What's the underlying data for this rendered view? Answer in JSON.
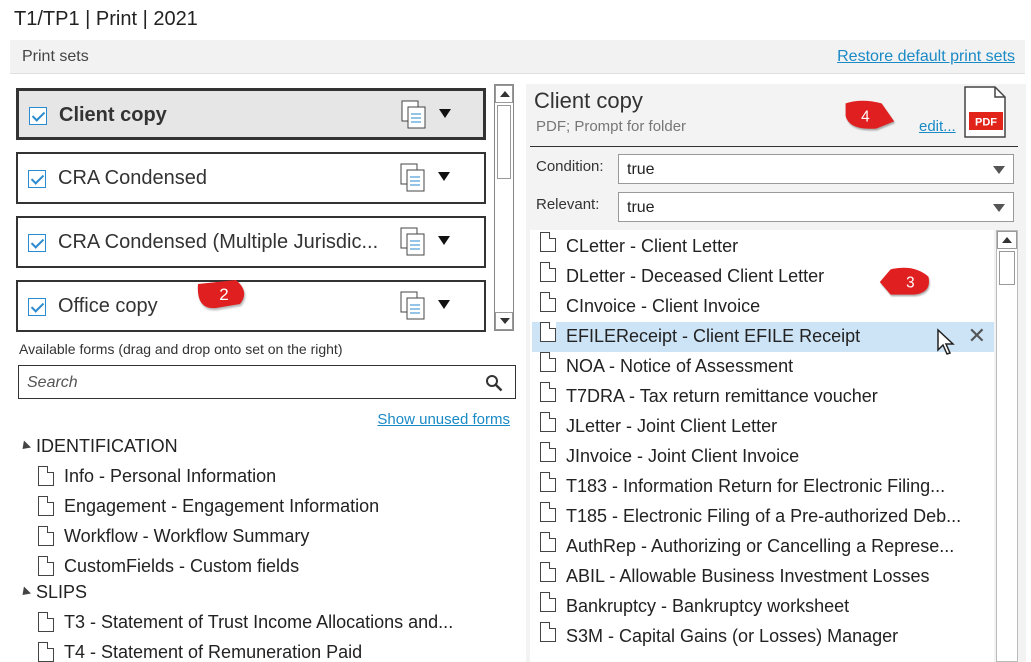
{
  "window": {
    "title": "T1/TP1 | Print | 2021"
  },
  "header": {
    "label": "Print sets",
    "restore_link": "Restore default print sets"
  },
  "print_sets": [
    {
      "name": "Client copy",
      "checked": true,
      "selected": true
    },
    {
      "name": "CRA Condensed",
      "checked": true,
      "selected": false
    },
    {
      "name": "CRA Condensed (Multiple Jurisdic...",
      "checked": true,
      "selected": false
    },
    {
      "name": "Office copy",
      "checked": true,
      "selected": false
    }
  ],
  "available": {
    "label": "Available forms (drag and drop onto set on the right)",
    "search_placeholder": "Search",
    "show_unused": "Show unused forms",
    "groups": [
      {
        "name": "IDENTIFICATION",
        "items": [
          "Info - Personal Information",
          "Engagement - Engagement Information",
          "Workflow - Workflow Summary",
          "CustomFields - Custom fields"
        ]
      },
      {
        "name": "SLIPS",
        "items": [
          "T3 - Statement of Trust Income Allocations and...",
          "T4 - Statement of Remuneration Paid"
        ]
      }
    ]
  },
  "detail": {
    "title": "Client copy",
    "subtitle": "PDF; Prompt for folder",
    "edit_link": "edit...",
    "pdf_icon_label": "PDF",
    "condition_label": "Condition:",
    "condition_value": "true",
    "relevant_label": "Relevant:",
    "relevant_value": "true",
    "forms": [
      "CLetter - Client Letter",
      "DLetter - Deceased Client Letter",
      "CInvoice - Client Invoice",
      "EFILEReceipt - Client EFILE Receipt",
      "NOA - Notice of Assessment",
      "T7DRA - Tax return remittance voucher",
      "JLetter - Joint Client Letter",
      "JInvoice - Joint Client Invoice",
      "T183 - Information Return for Electronic Filing...",
      "T185 - Electronic Filing of a Pre-authorized Deb...",
      "AuthRep - Authorizing or Cancelling a Represe...",
      "ABIL - Allowable Business Investment Losses",
      "Bankruptcy - Bankruptcy worksheet",
      "S3M - Capital Gains (or Losses) Manager"
    ],
    "selected_form_index": 3
  },
  "callouts": [
    "2",
    "3",
    "4"
  ],
  "colors": {
    "accent": "#1a8ac6",
    "selection": "#cde4f7",
    "callout": "#e02020",
    "pdf_red": "#e2231a"
  }
}
